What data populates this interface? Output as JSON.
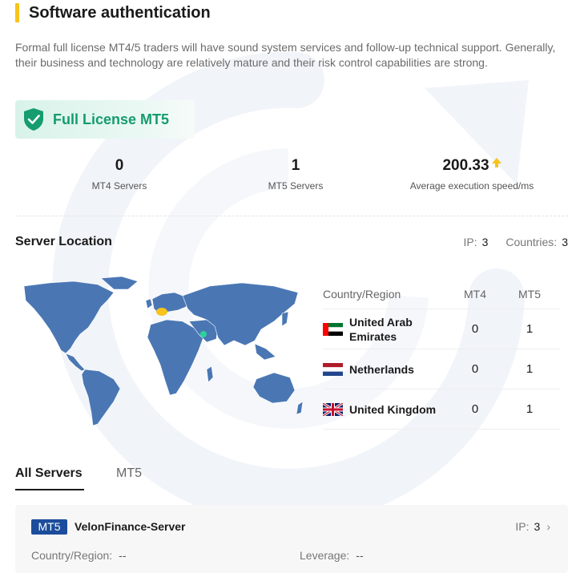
{
  "header": {
    "title": "Software authentication"
  },
  "description": "Formal full license MT4/5 traders will have sound system services and follow-up technical support. Generally, their business and technology are relatively mature and their risk control capabilities are strong.",
  "license": {
    "label": "Full License MT5",
    "icon": "shield-check-icon",
    "color": "#159c6f"
  },
  "stats": [
    {
      "value": "0",
      "label": "MT4 Servers"
    },
    {
      "value": "1",
      "label": "MT5 Servers"
    },
    {
      "value": "200.33",
      "label": "Average execution speed/ms",
      "trend_icon": "arrow-up-icon"
    }
  ],
  "server_location": {
    "title": "Server Location",
    "ip_label": "IP:",
    "ip_value": "3",
    "countries_label": "Countries:",
    "countries_value": "3",
    "table": {
      "headers": [
        "Country/Region",
        "MT4",
        "MT5"
      ],
      "rows": [
        {
          "country": "United Arab Emirates",
          "flag": "uae-flag-icon",
          "mt4": "0",
          "mt5": "1"
        },
        {
          "country": "Netherlands",
          "flag": "netherlands-flag-icon",
          "mt4": "0",
          "mt5": "1"
        },
        {
          "country": "United Kingdom",
          "flag": "uk-flag-icon",
          "mt4": "0",
          "mt5": "1"
        }
      ]
    }
  },
  "tabs": [
    {
      "label": "All Servers",
      "active": true
    },
    {
      "label": "MT5",
      "active": false
    }
  ],
  "server_card": {
    "badge": "MT5",
    "name": "VelonFinance-Server",
    "ip_label": "IP:",
    "ip_value": "3",
    "country_label": "Country/Region:",
    "country_value": "--",
    "leverage_label": "Leverage:",
    "leverage_value": "--"
  },
  "colors": {
    "accent_yellow": "#f7c31c",
    "license_green": "#159c6f",
    "map_blue": "#4a77b4",
    "badge_blue": "#1c4d9c"
  }
}
